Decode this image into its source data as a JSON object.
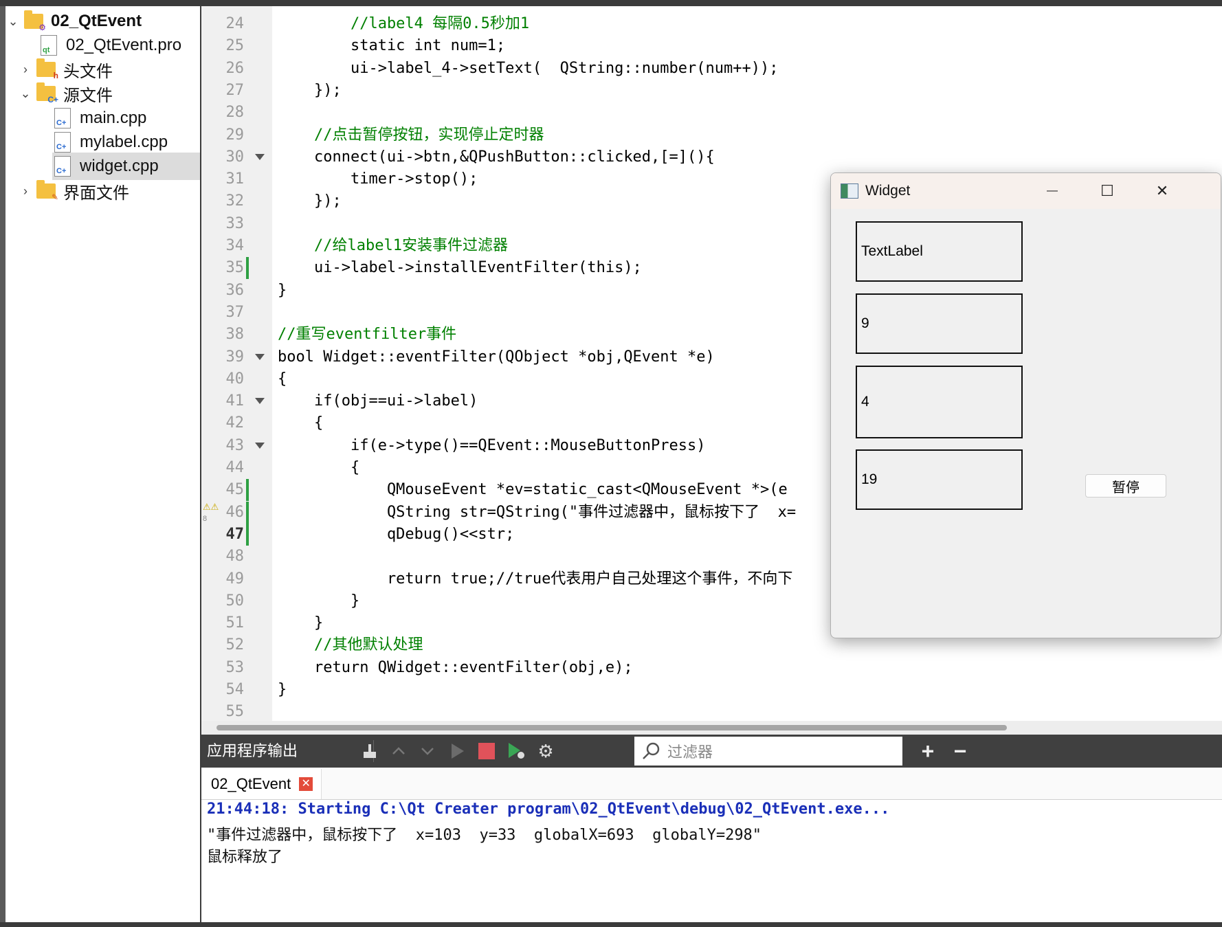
{
  "project_tree": {
    "items": [
      {
        "label": "02_QtEvent",
        "level": 0,
        "expanded": true,
        "icon": "project-folder-icon",
        "bold": true
      },
      {
        "label": "02_QtEvent.pro",
        "level": 1,
        "icon": "qt-pro-file-icon"
      },
      {
        "label": "头文件",
        "level": 1,
        "expanded": false,
        "icon": "header-folder-icon"
      },
      {
        "label": "源文件",
        "level": 1,
        "expanded": true,
        "icon": "source-folder-icon"
      },
      {
        "label": "main.cpp",
        "level": 2,
        "icon": "cpp-file-icon"
      },
      {
        "label": "mylabel.cpp",
        "level": 2,
        "icon": "cpp-file-icon"
      },
      {
        "label": "widget.cpp",
        "level": 2,
        "icon": "cpp-file-icon",
        "selected": true
      },
      {
        "label": "界面文件",
        "level": 1,
        "expanded": false,
        "icon": "form-folder-icon"
      }
    ]
  },
  "editor": {
    "current_line": 47,
    "lines": [
      {
        "n": "24",
        "code": "        //label4 每隔0.5秒加1"
      },
      {
        "n": "25",
        "code": "        static int num=1;"
      },
      {
        "n": "26",
        "code": "        ui->label_4->setText(  QString::number(num++));"
      },
      {
        "n": "27",
        "code": "    });"
      },
      {
        "n": "28",
        "code": ""
      },
      {
        "n": "29",
        "code": "    //点击暂停按钮，实现停止定时器"
      },
      {
        "n": "30",
        "code": "    connect(ui->btn,&QPushButton::clicked,[=](){",
        "fold": true
      },
      {
        "n": "31",
        "code": "        timer->stop();"
      },
      {
        "n": "32",
        "code": "    });"
      },
      {
        "n": "33",
        "code": ""
      },
      {
        "n": "34",
        "code": "    //给label1安装事件过滤器"
      },
      {
        "n": "35",
        "code": "    ui->label->installEventFilter(this);",
        "mod": true
      },
      {
        "n": "36",
        "code": "}"
      },
      {
        "n": "37",
        "code": ""
      },
      {
        "n": "38",
        "code": "//重写eventfilter事件"
      },
      {
        "n": "39",
        "code": "bool Widget::eventFilter(QObject *obj,QEvent *e)",
        "fold": true
      },
      {
        "n": "40",
        "code": "{"
      },
      {
        "n": "41",
        "code": "    if(obj==ui->label)",
        "fold": true
      },
      {
        "n": "42",
        "code": "    {"
      },
      {
        "n": "43",
        "code": "        if(e->type()==QEvent::MouseButtonPress)",
        "fold": true
      },
      {
        "n": "44",
        "code": "        {"
      },
      {
        "n": "45",
        "code": "            QMouseEvent *ev=static_cast<QMouseEvent *>(e",
        "mod": true
      },
      {
        "n": "46",
        "code": "            QString str=QString(\"事件过滤器中，鼠标按下了  x=",
        "mod": true,
        "warn": true
      },
      {
        "n": "47",
        "code": "            qDebug()<<str;",
        "mod": true
      },
      {
        "n": "48",
        "code": ""
      },
      {
        "n": "49",
        "code": "            return true;//true代表用户自己处理这个事件，不向下"
      },
      {
        "n": "50",
        "code": "        }"
      },
      {
        "n": "51",
        "code": "    }"
      },
      {
        "n": "52",
        "code": "    //其他默认处理"
      },
      {
        "n": "53",
        "code": "    return QWidget::eventFilter(obj,e);"
      },
      {
        "n": "54",
        "code": "}"
      },
      {
        "n": "55",
        "code": ""
      }
    ],
    "warning_count": "8"
  },
  "output": {
    "title": "应用程序输出",
    "filter_placeholder": "过滤器",
    "tab_label": "02_QtEvent",
    "tab_close": "✕",
    "lines": [
      "21:44:18: Starting C:\\Qt Creater program\\02_QtEvent\\debug\\02_QtEvent.exe...",
      "\"事件过滤器中，鼠标按下了  x=103  y=33  globalX=693  globalY=298\"",
      "鼠标释放了"
    ]
  },
  "widget_window": {
    "title": "Widget",
    "minimize": "—",
    "maximize": "☐",
    "close": "✕",
    "labels": [
      "TextLabel",
      "9",
      "4",
      "19"
    ],
    "button": "暂停"
  },
  "colors": {
    "keyword": "#808000",
    "type": "#800080",
    "comment": "#008000",
    "function": "#00677c",
    "output_start": "#1a2fb8"
  }
}
